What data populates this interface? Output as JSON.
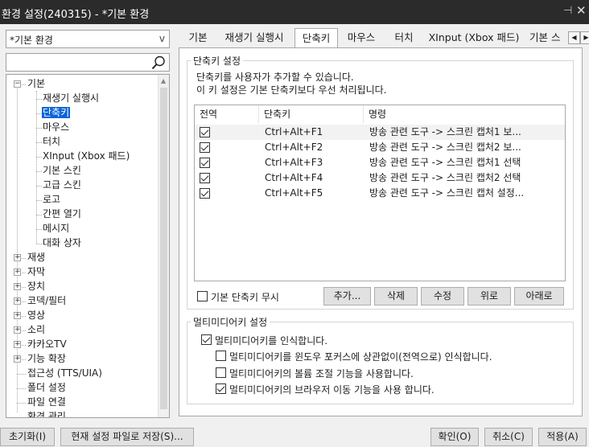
{
  "window": {
    "title": "환경 설정(240315) - *기본 환경",
    "pin_glyph": "⊣",
    "close_glyph": "✕"
  },
  "preset": {
    "value": "*기본 환경",
    "arrow": "v"
  },
  "search": {
    "value": "",
    "placeholder": ""
  },
  "tree": {
    "items": [
      {
        "label": "기본",
        "expander": "−"
      },
      {
        "label": "재생기 실행시"
      },
      {
        "label": "단축키",
        "selected": true
      },
      {
        "label": "마우스"
      },
      {
        "label": "터치"
      },
      {
        "label": "XInput (Xbox 패드)"
      },
      {
        "label": "기본 스킨"
      },
      {
        "label": "고급 스킨"
      },
      {
        "label": "로고"
      },
      {
        "label": "간편 열기"
      },
      {
        "label": "메시지"
      },
      {
        "label": "대화 상자"
      },
      {
        "label": "재생",
        "expander": "+"
      },
      {
        "label": "자막",
        "expander": "+"
      },
      {
        "label": "장치",
        "expander": "+"
      },
      {
        "label": "코덱/필터",
        "expander": "+"
      },
      {
        "label": "영상",
        "expander": "+"
      },
      {
        "label": "소리",
        "expander": "+"
      },
      {
        "label": "카카오TV",
        "expander": "+"
      },
      {
        "label": "기능 확장",
        "expander": "+"
      },
      {
        "label": "접근성 (TTS/UIA)"
      },
      {
        "label": "폴더 설정"
      },
      {
        "label": "파일 연결"
      },
      {
        "label": "환경 관리"
      }
    ]
  },
  "tabs": [
    "기본",
    "재생기 실행시",
    "단축키",
    "마우스",
    "터치",
    "XInput (Xbox 패드)",
    "기본 스"
  ],
  "tab_scroll": {
    "left": "◀",
    "right": "▶"
  },
  "shortcut_group": {
    "title": "단축키 설정",
    "desc1": "단축키를 사용자가 추가할 수 있습니다.",
    "desc2": "이 키 설정은 기본 단축키보다 우선 처리됩니다.",
    "columns": [
      "전역",
      "단축키",
      "명령"
    ],
    "rows": [
      {
        "global": true,
        "key": "Ctrl+Alt+F1",
        "command": "방송 관련 도구 -> 스크린 캡처1 보..."
      },
      {
        "global": true,
        "key": "Ctrl+Alt+F2",
        "command": "방송 관련 도구 -> 스크린 캡처2 보..."
      },
      {
        "global": true,
        "key": "Ctrl+Alt+F3",
        "command": "방송 관련 도구 -> 스크린 캡처1 선택"
      },
      {
        "global": true,
        "key": "Ctrl+Alt+F4",
        "command": "방송 관련 도구 -> 스크린 캡처2 선택"
      },
      {
        "global": true,
        "key": "Ctrl+Alt+F5",
        "command": "방송 관련 도구 -> 스크린 캡처 설정..."
      }
    ],
    "ignore_default_label": "기본 단축키 무시",
    "ignore_default_checked": false,
    "buttons": {
      "add": "추가...",
      "delete": "삭제",
      "edit": "수정",
      "up": "위로",
      "down": "아래로"
    }
  },
  "multimedia_group": {
    "title": "멀티미디어키 설정",
    "options": [
      {
        "label": "멀티미디어키를 인식합니다.",
        "checked": true
      },
      {
        "label": "멀티미디어키를 윈도우 포커스에 상관없이(전역으로) 인식합니다.",
        "checked": false
      },
      {
        "label": "멀티미디어키의 볼륨 조절 기능을 사용합니다.",
        "checked": false
      },
      {
        "label": "멀티미디어키의 브라우저 이동 기능을 사용 합니다.",
        "checked": true
      }
    ]
  },
  "footer": {
    "reset": "초기화(I)",
    "save_as": "현재 설정 파일로 저장(S)...",
    "ok": "확인(O)",
    "cancel": "취소(C)",
    "apply": "적용(A)"
  }
}
